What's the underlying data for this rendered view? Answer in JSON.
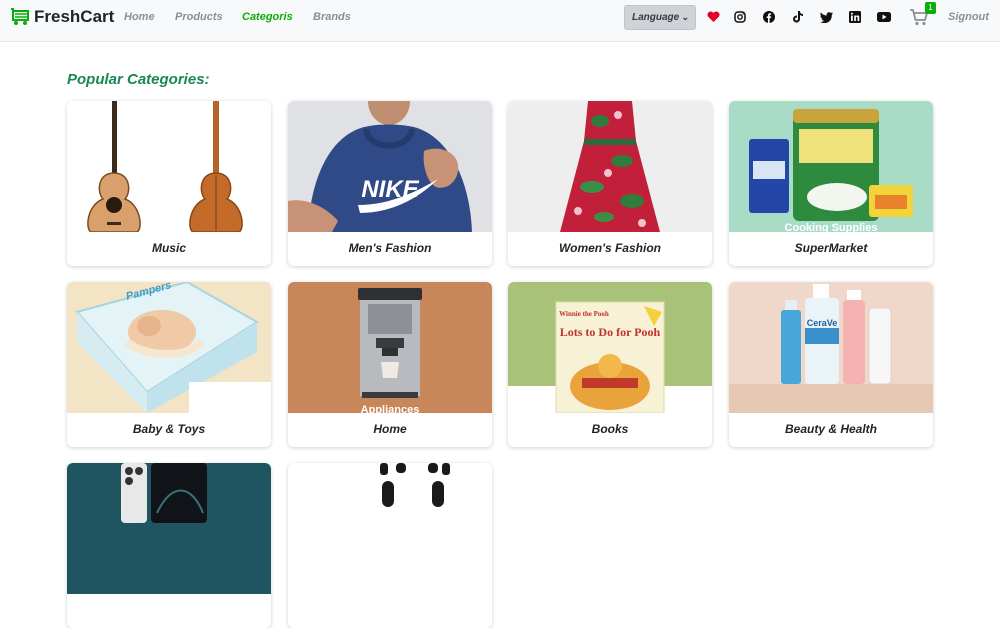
{
  "brand": {
    "name": "FreshCart"
  },
  "nav": {
    "home": "Home",
    "products": "Products",
    "categories": "Categoris",
    "brands": "Brands"
  },
  "language": {
    "label": "Language"
  },
  "cart": {
    "count": "1"
  },
  "signout": "Signout",
  "heading": "Popular Categories:",
  "categories": [
    {
      "name": "Music"
    },
    {
      "name": "Men's Fashion"
    },
    {
      "name": "Women's Fashion"
    },
    {
      "name": "SuperMarket"
    },
    {
      "name": "Baby & Toys"
    },
    {
      "name": "Home"
    },
    {
      "name": "Books"
    },
    {
      "name": "Beauty & Health"
    },
    {
      "name": ""
    },
    {
      "name": ""
    }
  ],
  "image_text": {
    "nike": "NIKE",
    "cooking": "Cooking Supplies",
    "appliances": "Appliances",
    "book_title": "Lots to Do for Pooh",
    "pooh_logo": "Winnie the Pooh",
    "pampers": "Pampers",
    "cerave": "CeraVe"
  },
  "colors": {
    "accent": "#0aad0a",
    "heading": "#198754"
  }
}
